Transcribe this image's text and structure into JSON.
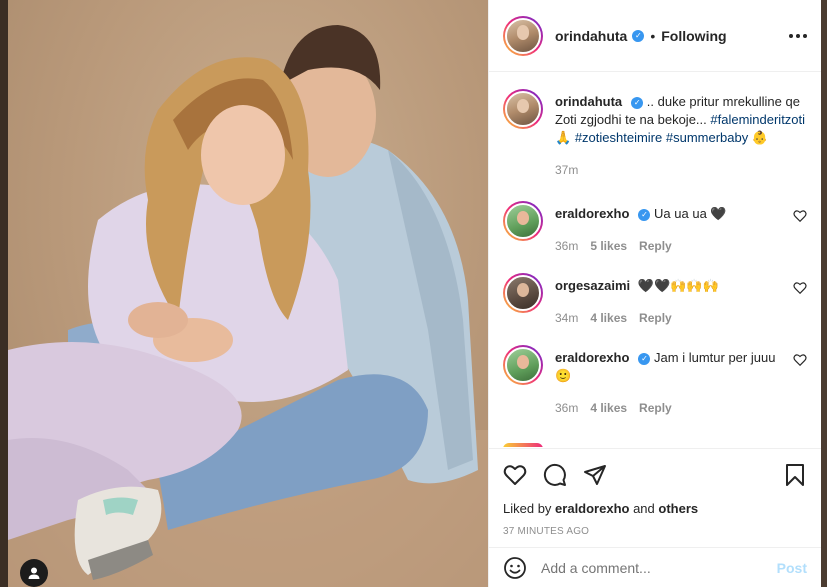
{
  "post": {
    "author": "orindahuta",
    "follow_status": "Following",
    "dot": "•",
    "caption_prefix": " .. duke pritur mrekulline qe Zoti zgjodhi te na bekoje... ",
    "hashtags": [
      "#faleminderitzoti",
      "#zotieshteimire",
      "#summerbaby"
    ],
    "caption_emoji_1": "🙏",
    "caption_emoji_2": "👶",
    "caption_time": "37m"
  },
  "comments": [
    {
      "user": "eraldorexho",
      "text": "Ua ua ua 🖤",
      "time": "36m",
      "likes": "5 likes",
      "reply": "Reply"
    },
    {
      "user": "orgesazaimi",
      "text": "🖤🖤🙌🙌🙌",
      "time": "34m",
      "likes": "4 likes",
      "reply": "Reply"
    },
    {
      "user": "eraldorexho",
      "text": "Jam i lumtur per juuu 🙂",
      "time": "36m",
      "likes": "4 likes",
      "reply": "Reply"
    }
  ],
  "likes_summary": {
    "prefix": "Liked by ",
    "user": "eraldorexho",
    "middle": " and ",
    "others": "others"
  },
  "timestamp": "37 MINUTES AGO",
  "add_comment": {
    "placeholder": "Add a comment...",
    "post_label": "Post"
  },
  "colors": {
    "link": "#00376b",
    "verified": "#3897f0",
    "post_disabled": "#b2dffc"
  }
}
